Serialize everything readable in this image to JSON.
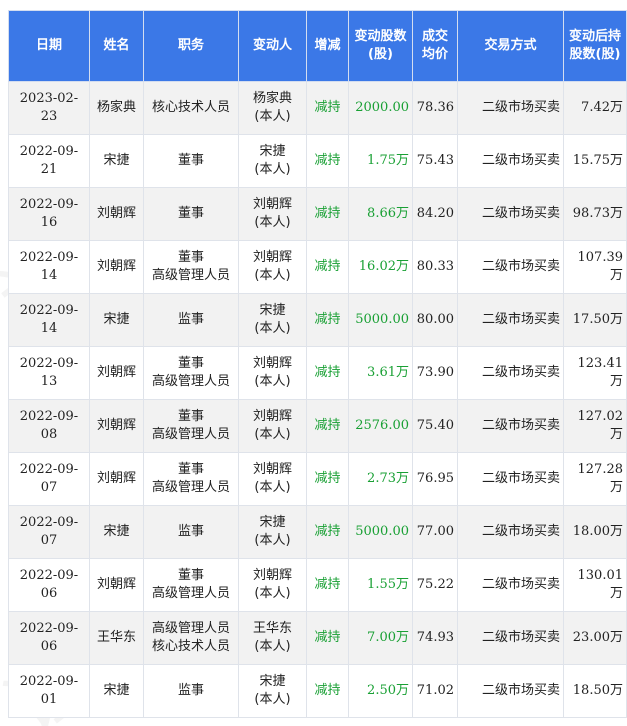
{
  "colors": {
    "header_bg": "#3b78e7",
    "header_text": "#ffffff",
    "decrease": "#19a034",
    "row_alt": "#f2f2f2"
  },
  "watermark_text": "证券之星",
  "headers": {
    "date": "日期",
    "name": "姓名",
    "position": "职务",
    "changer": "变动人",
    "change_type": "增减",
    "change_shares": "变动股数(股)",
    "price": "成交均价",
    "method": "交易方式",
    "holding_after": "变动后持股数(股)"
  },
  "rows": [
    {
      "date": "2023-02-23",
      "name": "杨家典",
      "position": [
        "核心技术人员"
      ],
      "changer": [
        "杨家典",
        "(本人)"
      ],
      "change_type": "减持",
      "shares": "2000.00",
      "price": "78.36",
      "method": "二级市场买卖",
      "after": "7.42万"
    },
    {
      "date": "2022-09-21",
      "name": "宋捷",
      "position": [
        "董事"
      ],
      "changer": [
        "宋捷",
        "(本人)"
      ],
      "change_type": "减持",
      "shares": "1.75万",
      "price": "75.43",
      "method": "二级市场买卖",
      "after": "15.75万"
    },
    {
      "date": "2022-09-16",
      "name": "刘朝辉",
      "position": [
        "董事"
      ],
      "changer": [
        "刘朝辉",
        "(本人)"
      ],
      "change_type": "减持",
      "shares": "8.66万",
      "price": "84.20",
      "method": "二级市场买卖",
      "after": "98.73万"
    },
    {
      "date": "2022-09-14",
      "name": "刘朝辉",
      "position": [
        "董事",
        "高级管理人员"
      ],
      "changer": [
        "刘朝辉",
        "(本人)"
      ],
      "change_type": "减持",
      "shares": "16.02万",
      "price": "80.33",
      "method": "二级市场买卖",
      "after": "107.39万"
    },
    {
      "date": "2022-09-14",
      "name": "宋捷",
      "position": [
        "监事"
      ],
      "changer": [
        "宋捷",
        "(本人)"
      ],
      "change_type": "减持",
      "shares": "5000.00",
      "price": "80.00",
      "method": "二级市场买卖",
      "after": "17.50万"
    },
    {
      "date": "2022-09-13",
      "name": "刘朝辉",
      "position": [
        "董事",
        "高级管理人员"
      ],
      "changer": [
        "刘朝辉",
        "(本人)"
      ],
      "change_type": "减持",
      "shares": "3.61万",
      "price": "73.90",
      "method": "二级市场买卖",
      "after": "123.41万"
    },
    {
      "date": "2022-09-08",
      "name": "刘朝辉",
      "position": [
        "董事",
        "高级管理人员"
      ],
      "changer": [
        "刘朝辉",
        "(本人)"
      ],
      "change_type": "减持",
      "shares": "2576.00",
      "price": "75.40",
      "method": "二级市场买卖",
      "after": "127.02万"
    },
    {
      "date": "2022-09-07",
      "name": "刘朝辉",
      "position": [
        "董事",
        "高级管理人员"
      ],
      "changer": [
        "刘朝辉",
        "(本人)"
      ],
      "change_type": "减持",
      "shares": "2.73万",
      "price": "76.95",
      "method": "二级市场买卖",
      "after": "127.28万"
    },
    {
      "date": "2022-09-07",
      "name": "宋捷",
      "position": [
        "监事"
      ],
      "changer": [
        "宋捷",
        "(本人)"
      ],
      "change_type": "减持",
      "shares": "5000.00",
      "price": "77.00",
      "method": "二级市场买卖",
      "after": "18.00万"
    },
    {
      "date": "2022-09-06",
      "name": "刘朝辉",
      "position": [
        "董事",
        "高级管理人员"
      ],
      "changer": [
        "刘朝辉",
        "(本人)"
      ],
      "change_type": "减持",
      "shares": "1.55万",
      "price": "75.22",
      "method": "二级市场买卖",
      "after": "130.01万"
    },
    {
      "date": "2022-09-06",
      "name": "王华东",
      "position": [
        "高级管理人员",
        "核心技术人员"
      ],
      "changer": [
        "王华东",
        "(本人)"
      ],
      "change_type": "减持",
      "shares": "7.00万",
      "price": "74.93",
      "method": "二级市场买卖",
      "after": "23.00万"
    },
    {
      "date": "2022-09-01",
      "name": "宋捷",
      "position": [
        "监事"
      ],
      "changer": [
        "宋捷",
        "(本人)"
      ],
      "change_type": "减持",
      "shares": "2.50万",
      "price": "71.02",
      "method": "二级市场买卖",
      "after": "18.50万"
    }
  ]
}
